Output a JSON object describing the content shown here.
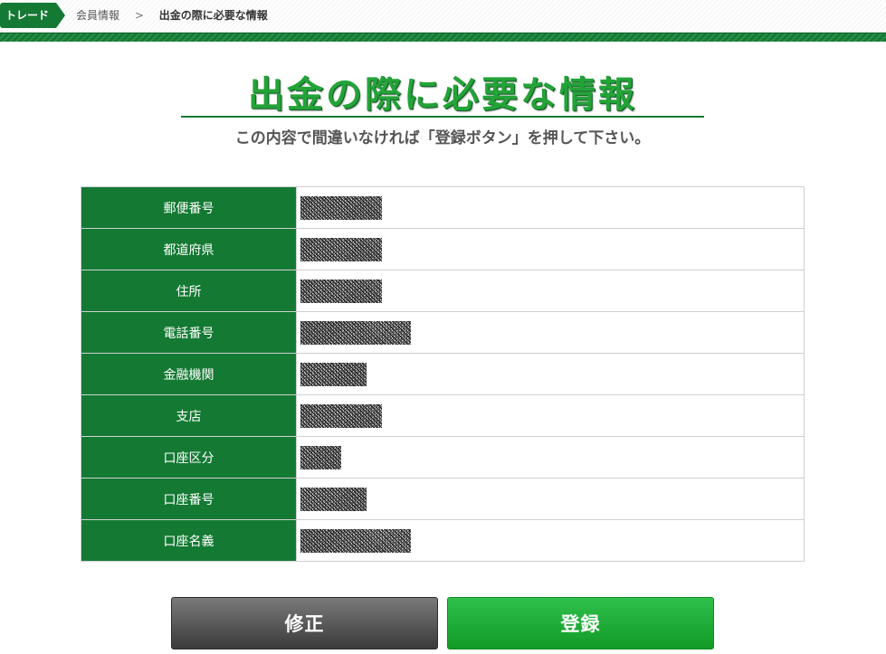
{
  "breadcrumb": {
    "home": "トレード",
    "items": [
      "会員情報",
      "出金の際に必要な情報"
    ],
    "separator": ">"
  },
  "page": {
    "title": "出金の際に必要な情報",
    "subtitle": "この内容で間違いなければ「登録ボタン」を押して下さい。"
  },
  "table": {
    "rows": [
      {
        "label": "郵便番号",
        "mask_units": 3
      },
      {
        "label": "都道府県",
        "mask_units": 3
      },
      {
        "label": "住所",
        "mask_units": 3
      },
      {
        "label": "電話番号",
        "mask_units": 4
      },
      {
        "label": "金融機関",
        "mask_units": 2.5
      },
      {
        "label": "支店",
        "mask_units": 3
      },
      {
        "label": "口座区分",
        "mask_units": 1.5
      },
      {
        "label": "口座番号",
        "mask_units": 2.5
      },
      {
        "label": "口座名義",
        "mask_units": 4
      }
    ]
  },
  "buttons": {
    "edit": "修正",
    "register": "登録"
  },
  "colors": {
    "brand_green": "#147a33",
    "title_green": "#24a338",
    "register_green": "#1eac37",
    "edit_gray": "#4a4a4a"
  }
}
